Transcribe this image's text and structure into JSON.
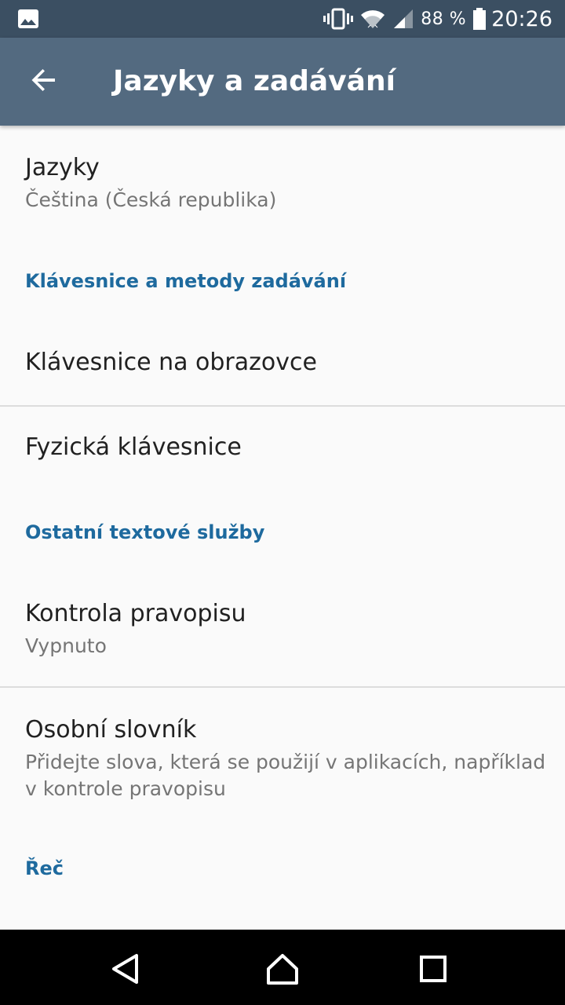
{
  "status_bar": {
    "left_icon": "image-notification-icon",
    "icons": [
      "vibrate-icon",
      "wifi-icon",
      "signal-icon"
    ],
    "battery_percent": "88 %",
    "battery_icon": "battery-icon",
    "time": "20:26"
  },
  "app_bar": {
    "title": "Jazyky a zadávání",
    "back_icon": "arrow-back-icon"
  },
  "settings": {
    "languages": {
      "title": "Jazyky",
      "summary": "Čeština (Česká republika)"
    },
    "keyboards_category": "Klávesnice a metody zadávání",
    "onscreen_keyboard": {
      "title": "Klávesnice na obrazovce"
    },
    "physical_keyboard": {
      "title": "Fyzická klávesnice"
    },
    "text_services_category": "Ostatní textové služby",
    "spell_check": {
      "title": "Kontrola pravopisu",
      "summary": "Vypnuto"
    },
    "personal_dictionary": {
      "title": "Osobní slovník",
      "summary": "Přidejte slova, která se použijí v aplikacích, například v kontrole pravopisu"
    },
    "speech_category": "Řeč"
  },
  "nav_bar": {
    "back_icon": "nav-back-icon",
    "home_icon": "nav-home-icon",
    "recents_icon": "nav-recents-icon"
  },
  "colors": {
    "status_bar": "#3b4f62",
    "app_bar": "#536a80",
    "accent": "#1e6a9e",
    "background": "#fafafa"
  }
}
